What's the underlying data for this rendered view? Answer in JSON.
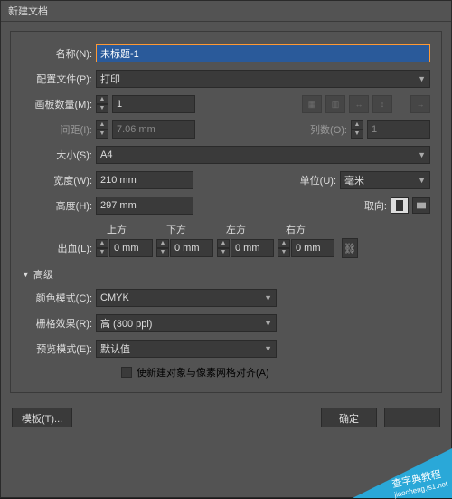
{
  "title": "新建文档",
  "labels": {
    "name": "名称(N):",
    "profile": "配置文件(P):",
    "artboards": "画板数量(M):",
    "spacing": "间距(I):",
    "columns": "列数(O):",
    "size": "大小(S):",
    "width": "宽度(W):",
    "height": "高度(H):",
    "units": "单位(U):",
    "orient": "取向:",
    "bleed": "出血(L):",
    "top": "上方",
    "bottom": "下方",
    "left": "左方",
    "right": "右方",
    "advanced": "高级",
    "colormode": "颜色模式(C):",
    "raster": "栅格效果(R):",
    "preview": "预览模式(E):",
    "alignpx": "使新建对象与像素网格对齐(A)"
  },
  "values": {
    "name": "未标题-1",
    "profile": "打印",
    "artboards": "1",
    "spacing": "7.06 mm",
    "columns": "1",
    "size": "A4",
    "width": "210 mm",
    "height": "297 mm",
    "units": "毫米",
    "bleed_top": "0 mm",
    "bleed_bottom": "0 mm",
    "bleed_left": "0 mm",
    "bleed_right": "0 mm",
    "colormode": "CMYK",
    "raster": "高 (300 ppi)",
    "preview": "默认值"
  },
  "buttons": {
    "template": "模板(T)...",
    "ok": "确定"
  },
  "watermark": {
    "l1": "查字典教程",
    "l2": "jiaocheng.js1.net"
  }
}
